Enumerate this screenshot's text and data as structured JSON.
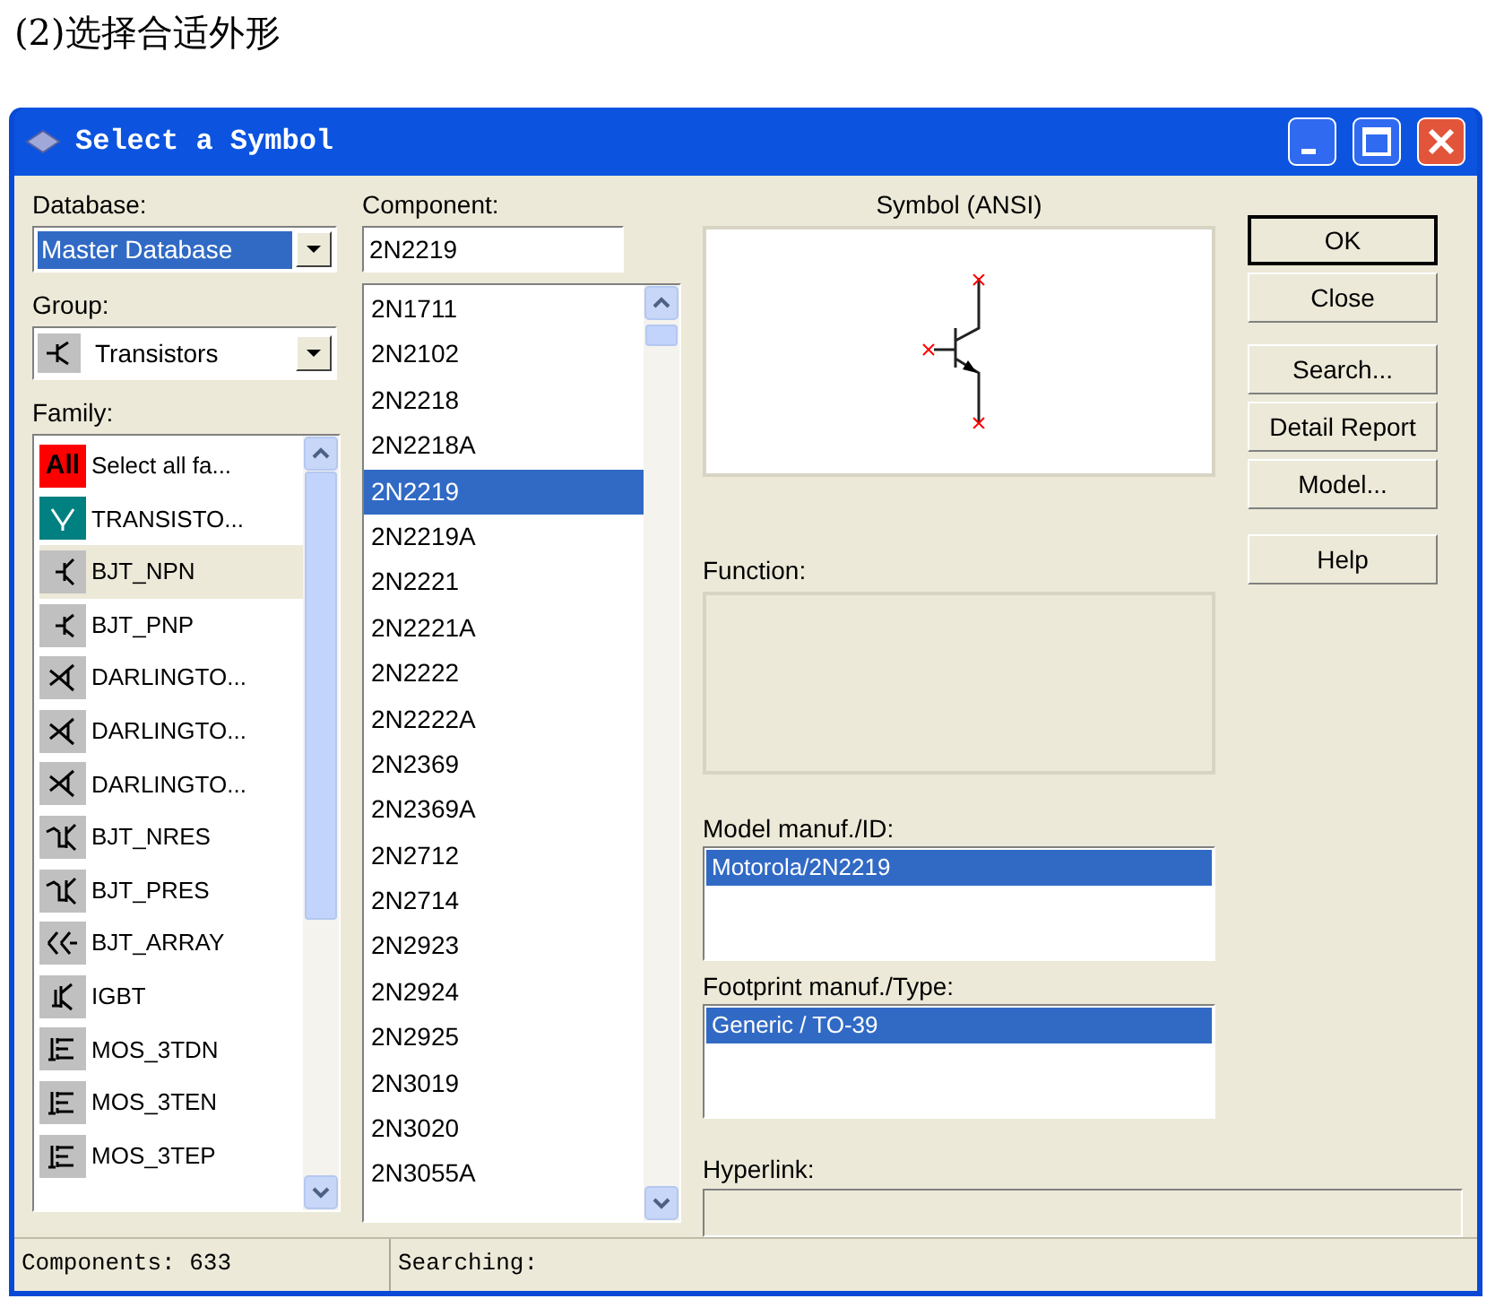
{
  "caption": "(2)选择合适外形",
  "window": {
    "title": "Select a Symbol"
  },
  "database": {
    "label": "Database:",
    "value": "Master Database"
  },
  "group": {
    "label": "Group:",
    "value": "Transistors"
  },
  "family": {
    "label": "Family:",
    "items": [
      {
        "kind": "all",
        "badge": "All",
        "label": "Select all fa...",
        "selected": false
      },
      {
        "kind": "virtual",
        "label": "TRANSISTO...",
        "selected": false
      },
      {
        "kind": "npn",
        "label": "BJT_NPN",
        "selected": true
      },
      {
        "kind": "pnp",
        "label": "BJT_PNP",
        "selected": false
      },
      {
        "kind": "darlington",
        "label": "DARLINGTO...",
        "selected": false
      },
      {
        "kind": "darlington",
        "label": "DARLINGTO...",
        "selected": false
      },
      {
        "kind": "darlington",
        "label": "DARLINGTO...",
        "selected": false
      },
      {
        "kind": "res",
        "label": "BJT_NRES",
        "selected": false
      },
      {
        "kind": "res",
        "label": "BJT_PRES",
        "selected": false
      },
      {
        "kind": "array",
        "label": "BJT_ARRAY",
        "selected": false
      },
      {
        "kind": "igbt",
        "label": "IGBT",
        "selected": false
      },
      {
        "kind": "mos",
        "label": "MOS_3TDN",
        "selected": false
      },
      {
        "kind": "mos",
        "label": "MOS_3TEN",
        "selected": false
      },
      {
        "kind": "mos",
        "label": "MOS_3TEP",
        "selected": false
      }
    ]
  },
  "component": {
    "label": "Component:",
    "value": "2N2219",
    "items": [
      {
        "label": "2N1711",
        "selected": false
      },
      {
        "label": "2N2102",
        "selected": false
      },
      {
        "label": "2N2218",
        "selected": false
      },
      {
        "label": "2N2218A",
        "selected": false
      },
      {
        "label": "2N2219",
        "selected": true
      },
      {
        "label": "2N2219A",
        "selected": false
      },
      {
        "label": "2N2221",
        "selected": false
      },
      {
        "label": "2N2221A",
        "selected": false
      },
      {
        "label": "2N2222",
        "selected": false
      },
      {
        "label": "2N2222A",
        "selected": false
      },
      {
        "label": "2N2369",
        "selected": false
      },
      {
        "label": "2N2369A",
        "selected": false
      },
      {
        "label": "2N2712",
        "selected": false
      },
      {
        "label": "2N2714",
        "selected": false
      },
      {
        "label": "2N2923",
        "selected": false
      },
      {
        "label": "2N2924",
        "selected": false
      },
      {
        "label": "2N2925",
        "selected": false
      },
      {
        "label": "2N3019",
        "selected": false
      },
      {
        "label": "2N3020",
        "selected": false
      },
      {
        "label": "2N3055A",
        "selected": false
      }
    ]
  },
  "symbol": {
    "label": "Symbol (ANSI)"
  },
  "function": {
    "label": "Function:"
  },
  "model": {
    "label": "Model manuf./ID:",
    "items": [
      {
        "label": "Motorola/2N2219",
        "selected": true
      }
    ]
  },
  "footprint": {
    "label": "Footprint manuf./Type:",
    "items": [
      {
        "label": "Generic / TO-39",
        "selected": true
      }
    ]
  },
  "hyperlink": {
    "label": "Hyperlink:"
  },
  "buttons": [
    {
      "label": "OK",
      "default": true
    },
    {
      "label": "Close",
      "default": false
    },
    {
      "label": "Search...",
      "default": false
    },
    {
      "label": "Detail Report",
      "default": false
    },
    {
      "label": "Model...",
      "default": false
    },
    {
      "label": "Help",
      "default": false
    }
  ],
  "status_bar": [
    {
      "text": "Components: 633"
    },
    {
      "text": "Searching:"
    }
  ]
}
